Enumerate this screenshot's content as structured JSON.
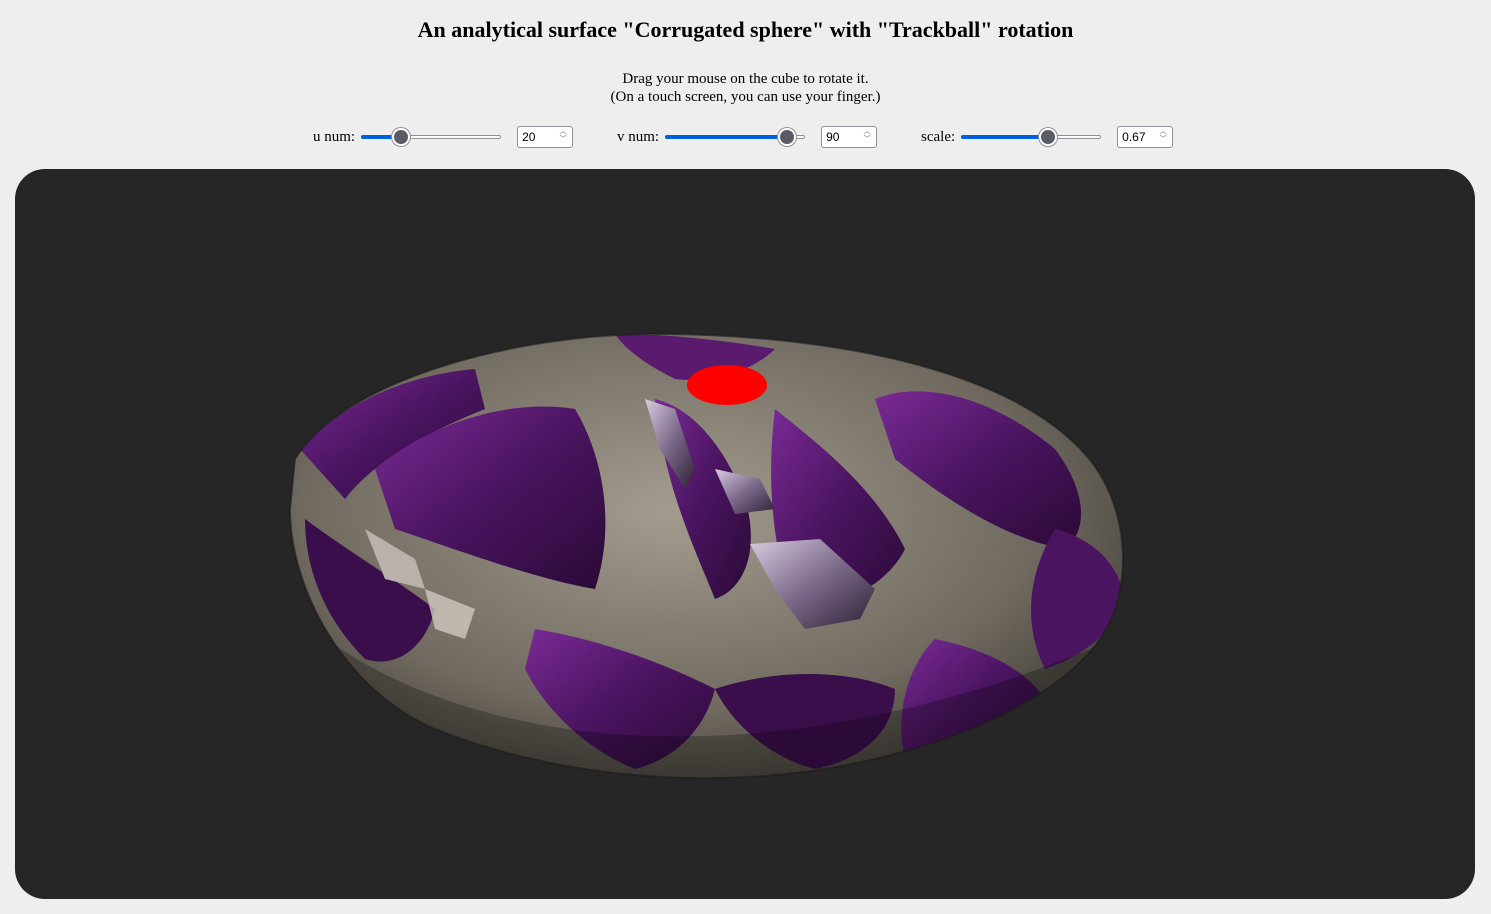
{
  "page": {
    "title": "An analytical surface \"Corrugated sphere\" with \"Trackball\" rotation",
    "instructions": [
      "Drag your mouse on the cube to rotate it.",
      "(On a touch screen, you can use your finger.)"
    ]
  },
  "controls": {
    "u_num": {
      "label": "u num:",
      "value": "20",
      "fraction": 0.25
    },
    "v_num": {
      "label": "v num:",
      "value": "90",
      "fraction": 0.93
    },
    "scale": {
      "label": "scale:",
      "value": "0.67",
      "fraction": 0.64
    }
  },
  "colors": {
    "accent": "#0060df",
    "canvas_bg": "#262626",
    "page_bg": "#eeeeee",
    "surface_purple": "#5a1a6e",
    "surface_stone": "#8a8478",
    "marker": "#ff0000"
  },
  "icons": {
    "spin_arrows": "spin-arrows-icon"
  }
}
